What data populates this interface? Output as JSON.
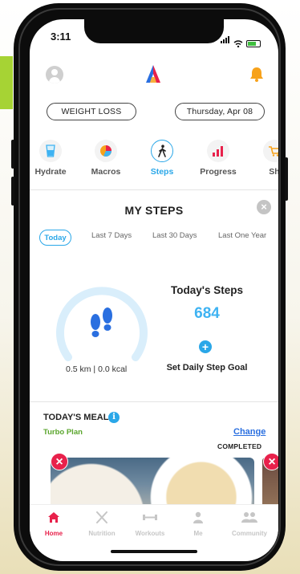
{
  "status_bar": {
    "time": "3:11"
  },
  "header": {
    "filter_label": "WEIGHT LOSS",
    "date_label": "Thursday, Apr 08"
  },
  "tabs": [
    {
      "label": "Hydrate",
      "icon": "water-glass-icon"
    },
    {
      "label": "Macros",
      "icon": "pie-chart-icon"
    },
    {
      "label": "Steps",
      "icon": "walking-person-icon",
      "active": true
    },
    {
      "label": "Progress",
      "icon": "bar-chart-icon"
    },
    {
      "label": "Sh",
      "icon": "shopping-cart-icon"
    }
  ],
  "steps": {
    "title": "MY STEPS",
    "close_label": "×",
    "ranges": [
      "Today",
      "Last 7 Days",
      "Last 30 Days",
      "Last One Year"
    ],
    "gauge_stats": "0.5 km | 0.0 kcal",
    "today_label": "Today's Steps",
    "today_value": "684",
    "goal_plus": "+",
    "goal_label": "Set Daily Step Goal"
  },
  "meals": {
    "title": "TODAY'S MEALS",
    "info": "i",
    "plan": "Turbo Plan",
    "change": "Change",
    "status": "COMPLETED",
    "remove": "×"
  },
  "bottom_nav": [
    {
      "label": "Home",
      "icon": "home-icon",
      "active": true
    },
    {
      "label": "Nutrition",
      "icon": "fork-knife-icon"
    },
    {
      "label": "Workouts",
      "icon": "dumbbell-icon"
    },
    {
      "label": "Me",
      "icon": "person-icon"
    },
    {
      "label": "Community",
      "icon": "group-icon"
    }
  ],
  "colors": {
    "accent": "#2aa7e8",
    "home_active": "#e8214b",
    "plan_green": "#5aa52c",
    "bell": "#f7a21b"
  }
}
